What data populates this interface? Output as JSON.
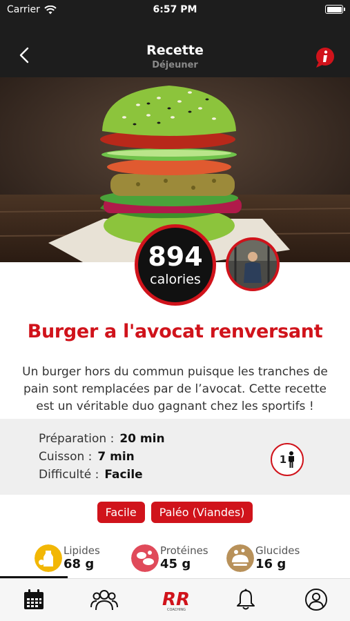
{
  "status": {
    "carrier": "Carrier",
    "time": "6:57 PM"
  },
  "nav": {
    "title": "Recette",
    "subtitle": "Déjeuner",
    "back_icon": "chevron-left-icon",
    "info_icon": "info-icon"
  },
  "calories": {
    "value": "894",
    "unit": "calories"
  },
  "recipe": {
    "title": "Burger a l'avocat renversant",
    "description": "Un burger hors du commun puisque les tranches de pain sont remplacées par de l’avocat. Cette recette est un véritable duo gagnant chez les sportifs !"
  },
  "details": {
    "prep_label": "Préparation :",
    "prep_value": "20 min",
    "cook_label": "Cuisson :",
    "cook_value": "7 min",
    "difficulty_label": "Difficulté :",
    "difficulty_value": "Facile",
    "servings": "1"
  },
  "tags": [
    "Facile",
    "Paléo (Viandes)"
  ],
  "macros": [
    {
      "label": "Lipides",
      "value": "68 g",
      "color": "#f2b705"
    },
    {
      "label": "Protéines",
      "value": "45 g",
      "color": "#e04a5a"
    },
    {
      "label": "Glucides",
      "value": "16 g",
      "color": "#b8915a"
    }
  ],
  "tabbar": {
    "items": [
      "calendar-icon",
      "community-icon",
      "rr-coaching-logo",
      "bell-icon",
      "profile-icon"
    ],
    "logo_text": "RR",
    "logo_sub": "COACHING"
  },
  "colors": {
    "accent": "#d0131b",
    "dark": "#1d1d1d"
  }
}
